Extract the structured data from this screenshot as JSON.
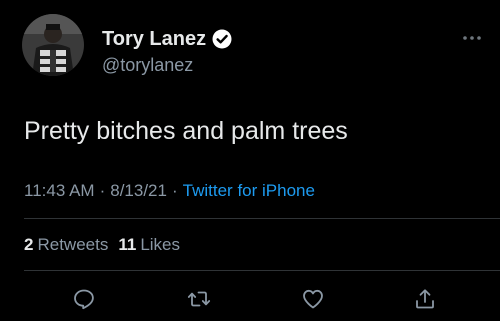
{
  "user": {
    "display_name": "Tory Lanez",
    "handle": "@torylanez",
    "verified_icon": "verified-badge-icon",
    "avatar_icon": "profile-photo"
  },
  "tweet": {
    "text": "Pretty bitches and palm trees"
  },
  "meta": {
    "time": "11:43 AM",
    "separator": "·",
    "date": "8/13/21",
    "source": "Twitter for iPhone"
  },
  "stats": {
    "retweets_count": "2",
    "retweets_label": "Retweets",
    "likes_count": "11",
    "likes_label": "Likes"
  },
  "actions": [
    "reply-icon",
    "retweet-icon",
    "like-icon",
    "share-icon"
  ],
  "colors": {
    "background": "#000000",
    "primary_text": "#e7e9ea",
    "secondary_text": "#8b98a5",
    "link": "#1d9bf0",
    "divider": "#2f3336"
  }
}
